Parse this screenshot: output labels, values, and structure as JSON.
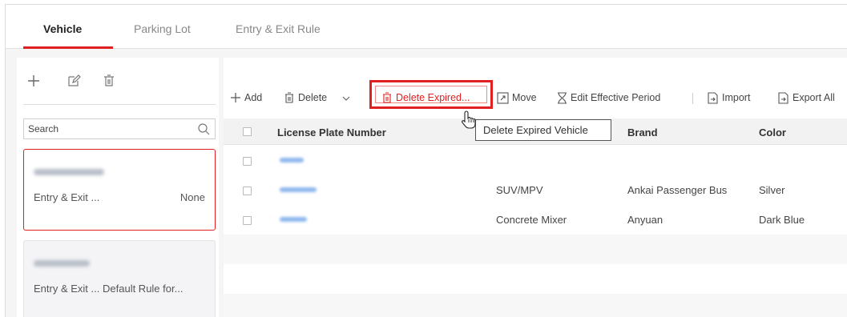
{
  "tabs": [
    {
      "label": "Vehicle",
      "active": true
    },
    {
      "label": "Parking Lot",
      "active": false
    },
    {
      "label": "Entry & Exit Rule",
      "active": false
    }
  ],
  "left_panel": {
    "toolbar_icons": [
      "plus-icon",
      "edit-icon",
      "trash-icon"
    ],
    "search": {
      "value": "Search"
    },
    "lists": [
      {
        "name": "",
        "rule_label": "Entry & Exit ...",
        "rule_value": "None",
        "selected": true
      },
      {
        "name": "",
        "rule_label": "Entry & Exit ...",
        "rule_value": "Default Rule for...",
        "selected": false
      }
    ]
  },
  "toolbar": {
    "add": "Add",
    "delete": "Delete",
    "delete_expired": "Delete Expired...",
    "move": "Move",
    "edit_period": "Edit Effective Period",
    "import": "Import",
    "export_all": "Export All"
  },
  "table": {
    "headers": {
      "plate": "License Plate Number",
      "brand": "Brand",
      "color": "Color"
    },
    "rows": [
      {
        "plate": "",
        "type": "",
        "brand": "",
        "color": ""
      },
      {
        "plate": "",
        "type": "SUV/MPV",
        "brand": "Ankai Passenger Bus",
        "color": "Silver"
      },
      {
        "plate": "",
        "type": "Concrete Mixer",
        "brand": "Anyuan",
        "color": "Dark Blue"
      }
    ]
  },
  "tooltip": "Delete Expired Vehicle",
  "colors": {
    "accent": "#e02020",
    "link": "#8fb8ee"
  }
}
